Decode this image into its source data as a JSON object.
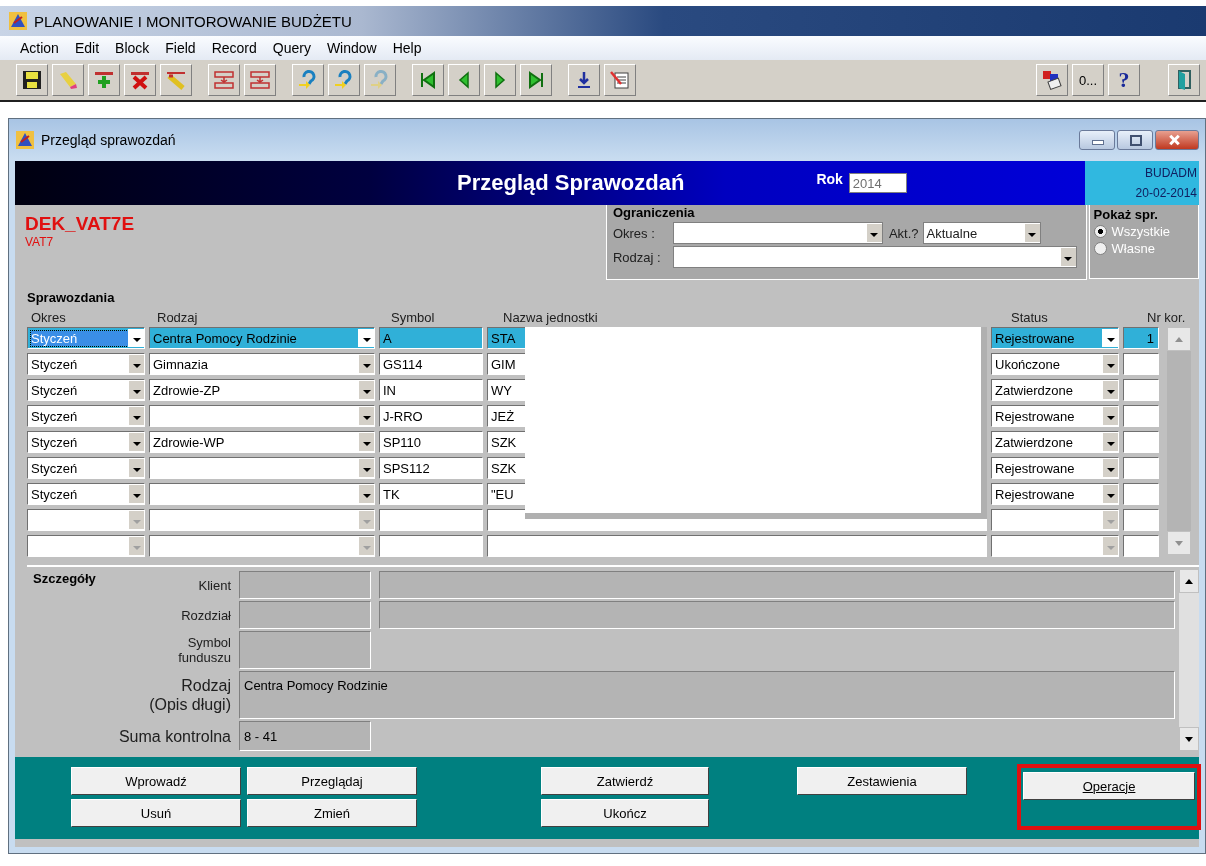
{
  "app_title": "PLANOWANIE I MONITOROWANIE BUDŻETU",
  "menu": [
    "Action",
    "Edit",
    "Block",
    "Field",
    "Record",
    "Query",
    "Window",
    "Help"
  ],
  "toolbar_text_button": "0...",
  "toolbar_help": "?",
  "window": {
    "title": "Przegląd sprawozdań"
  },
  "banner": {
    "title": "Przegląd Sprawozdań",
    "year_label": "Rok",
    "year": "2014",
    "user": "BUDADM",
    "date": "20-02-2014"
  },
  "report": {
    "code": "DEK_VAT7E",
    "subcode": "VAT7"
  },
  "filters": {
    "title": "Ograniczenia",
    "period_label": "Okres :",
    "active_label": "Akt.?",
    "active_value": "Aktualne",
    "type_label": "Rodzaj :"
  },
  "show": {
    "title": "Pokaż spr.",
    "options": [
      {
        "label": "Wszystkie",
        "selected": true
      },
      {
        "label": "Własne",
        "selected": false
      }
    ]
  },
  "table": {
    "title": "Sprawozdania",
    "columns": [
      "Okres",
      "Rodzaj",
      "Symbol",
      "Nazwa jednostki",
      "Status",
      "Nr kor."
    ],
    "rows": [
      {
        "okres": "Styczeń",
        "rodzaj": "Centra Pomocy Rodzinie",
        "symbol": "A",
        "nazwa": "STA",
        "status": "Rejestrowane",
        "nr_kor": "1",
        "selected": true
      },
      {
        "okres": "Styczeń",
        "rodzaj": "Gimnazia",
        "symbol": "GS114",
        "nazwa": "GIM",
        "status": "Ukończone",
        "selected": false
      },
      {
        "okres": "Styczeń",
        "rodzaj": "Zdrowie-ZP",
        "symbol": "IN",
        "nazwa": "WY",
        "status": "Zatwierdzone",
        "selected": false
      },
      {
        "okres": "Styczeń",
        "symbol": "J-RRO",
        "nazwa": "JEŻ",
        "status": "Rejestrowane",
        "selected": false
      },
      {
        "okres": "Styczeń",
        "rodzaj": "Zdrowie-WP",
        "symbol": "SP110",
        "nazwa": "SZK",
        "status": "Zatwierdzone",
        "selected": false
      },
      {
        "okres": "Styczeń",
        "symbol": "SPS112",
        "nazwa": "SZK",
        "status": "Rejestrowane",
        "selected": false
      },
      {
        "okres": "Styczeń",
        "symbol": "TK",
        "nazwa": "\"EU",
        "status": "Rejestrowane",
        "selected": false
      },
      {
        "selected": false
      },
      {
        "selected": false
      }
    ]
  },
  "details": {
    "title": "Szczegóły",
    "client_label": "Klient",
    "chapter_label": "Rozdział",
    "fund_label_1": "Symbol",
    "fund_label_2": "funduszu",
    "type_label_1": "Rodzaj",
    "type_label_2": "(Opis długi)",
    "type_value": "Centra Pomocy Rodzinie",
    "checksum_label": "Suma kontrolna",
    "checksum_value": "8 - 41"
  },
  "buttons": [
    {
      "label": "Wprowadź",
      "highlighted": false
    },
    {
      "label": "Przeglądaj",
      "highlighted": false
    },
    {
      "label": "Zatwierdź",
      "highlighted": false
    },
    {
      "label": "Zestawienia",
      "highlighted": false
    },
    {
      "label": "Operacje",
      "highlighted": true
    },
    {
      "label": "Usuń",
      "highlighted": false
    },
    {
      "label": "Zmień",
      "highlighted": false
    },
    {
      "label": "Ukończ",
      "highlighted": false
    }
  ]
}
